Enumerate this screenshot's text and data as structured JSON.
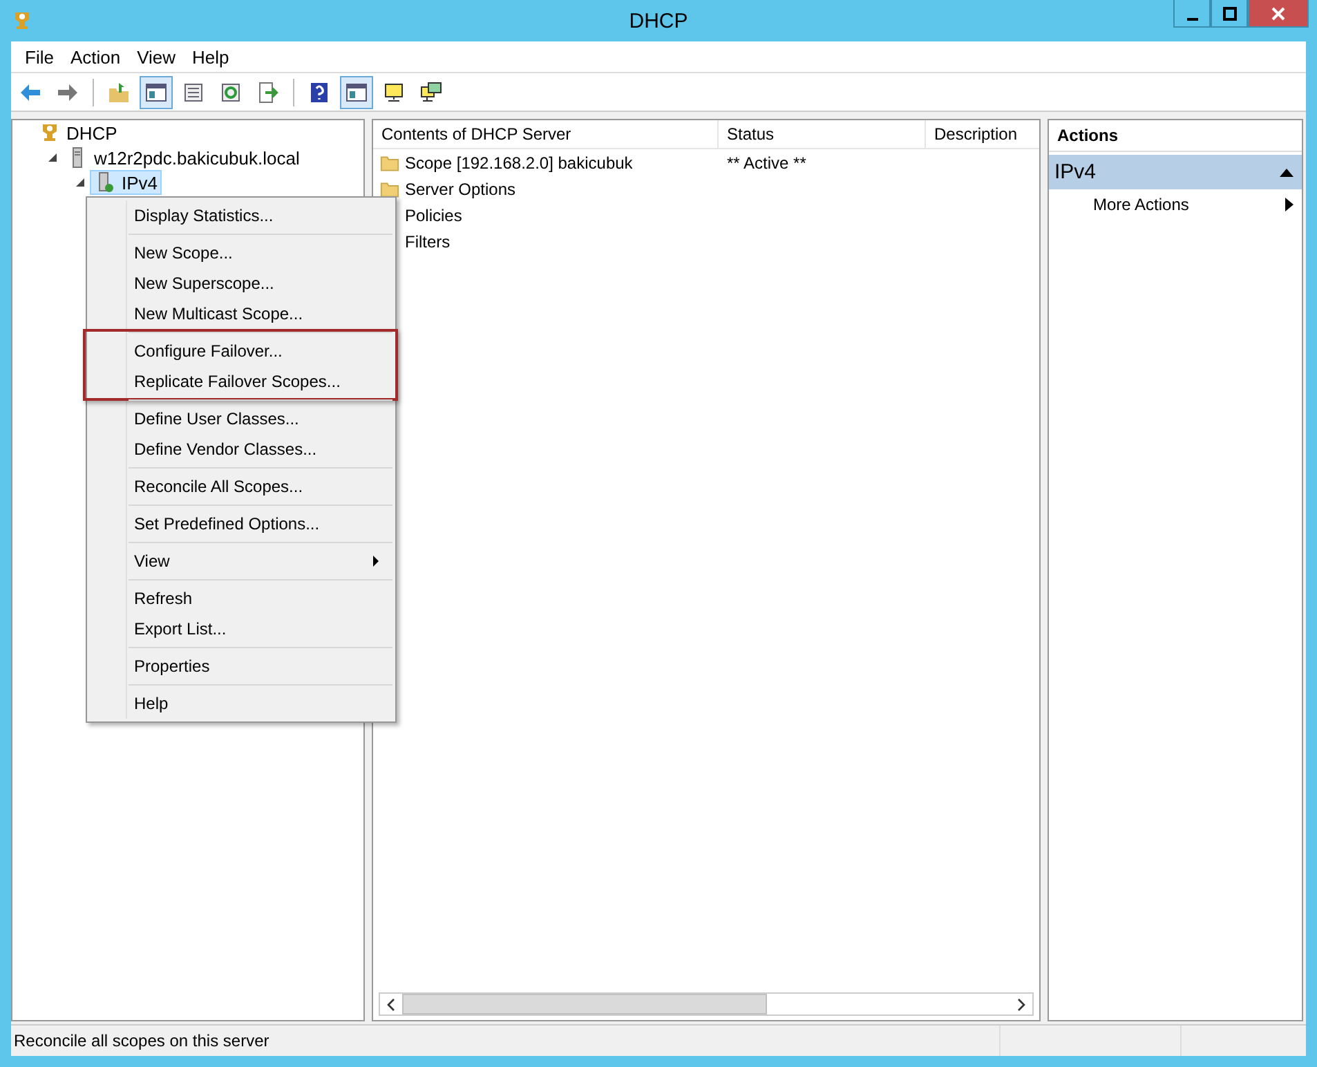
{
  "window": {
    "title": "DHCP"
  },
  "menu_bar": [
    "File",
    "Action",
    "View",
    "Help"
  ],
  "toolbar": [
    [
      {
        "kind": "back",
        "pressed": false
      },
      {
        "kind": "forward",
        "pressed": false
      }
    ],
    [
      {
        "kind": "up",
        "pressed": false
      },
      {
        "kind": "tree",
        "pressed": true
      },
      {
        "kind": "props",
        "pressed": false
      },
      {
        "kind": "refresh",
        "pressed": false
      },
      {
        "kind": "export",
        "pressed": false
      }
    ],
    [
      {
        "kind": "help",
        "pressed": false
      },
      {
        "kind": "pane",
        "pressed": true
      },
      {
        "kind": "monitor",
        "pressed": false
      },
      {
        "kind": "monitors",
        "pressed": false
      }
    ]
  ],
  "tree": [
    {
      "label": "DHCP",
      "selected": false,
      "children": [
        {
          "label": "w12r2pdc.bakicubuk.local",
          "expanded": true,
          "selected": false,
          "children": [
            {
              "label": "IPv4",
              "expanded": true,
              "selected": true
            }
          ]
        }
      ]
    }
  ],
  "context_menu": {
    "groups": [
      {
        "highlighted": false,
        "items": [
          {
            "label": "Display Statistics...",
            "submenu": false
          }
        ]
      },
      {
        "highlighted": false,
        "items": [
          {
            "label": "New Scope...",
            "submenu": false
          },
          {
            "label": "New Superscope...",
            "submenu": false
          },
          {
            "label": "New Multicast Scope...",
            "submenu": false
          }
        ]
      },
      {
        "highlighted": true,
        "items": [
          {
            "label": "Configure Failover...",
            "submenu": false
          },
          {
            "label": "Replicate Failover Scopes...",
            "submenu": false
          }
        ]
      },
      {
        "highlighted": false,
        "items": [
          {
            "label": "Define User Classes...",
            "submenu": false
          },
          {
            "label": "Define Vendor Classes...",
            "submenu": false
          }
        ]
      },
      {
        "highlighted": false,
        "items": [
          {
            "label": "Reconcile All Scopes...",
            "submenu": false
          }
        ]
      },
      {
        "highlighted": false,
        "items": [
          {
            "label": "Set Predefined Options...",
            "submenu": false
          }
        ]
      },
      {
        "highlighted": false,
        "items": [
          {
            "label": "View",
            "submenu": true
          }
        ]
      },
      {
        "highlighted": false,
        "items": [
          {
            "label": "Refresh",
            "submenu": false
          },
          {
            "label": "Export List...",
            "submenu": false
          }
        ]
      },
      {
        "highlighted": false,
        "items": [
          {
            "label": "Properties",
            "submenu": false
          }
        ]
      },
      {
        "highlighted": false,
        "items": [
          {
            "label": "Help",
            "submenu": false
          }
        ]
      }
    ]
  },
  "table": {
    "columns": [
      "Contents of DHCP Server",
      "Status",
      "Description"
    ],
    "rows": [
      {
        "name": "Scope [192.168.2.0] bakicubuk",
        "status": "** Active **",
        "kind": "folder"
      },
      {
        "name": "Server Options",
        "kind": "folder"
      },
      {
        "name": "Policies"
      },
      {
        "name": "Filters"
      }
    ]
  },
  "actions": {
    "title": "Actions",
    "section": "IPv4",
    "expanded": true,
    "items": [
      {
        "label": "More Actions",
        "submenu": true
      }
    ]
  },
  "status_bar": {
    "text": "Reconcile all scopes on this server"
  }
}
